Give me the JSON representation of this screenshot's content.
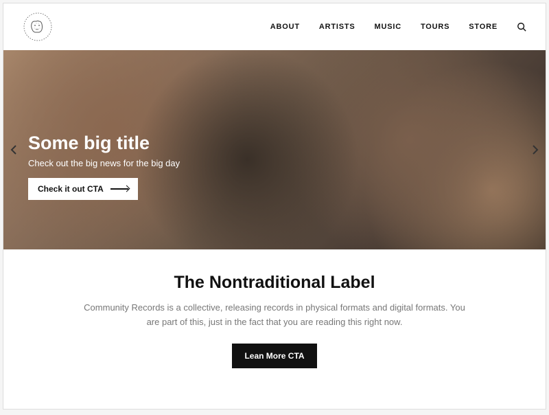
{
  "nav": {
    "items": [
      "ABOUT",
      "ARTISTS",
      "MUSIC",
      "TOURS",
      "STORE"
    ]
  },
  "hero": {
    "title": "Some big title",
    "subtitle": "Check out the big news for the big day",
    "cta": "Check it out CTA"
  },
  "about": {
    "title": "The Nontraditional Label",
    "body": "Community Records is a collective, releasing records in physical formats and digital formats. You are part of this, just in the fact that you are reading this right now.",
    "cta": "Lean More CTA"
  }
}
